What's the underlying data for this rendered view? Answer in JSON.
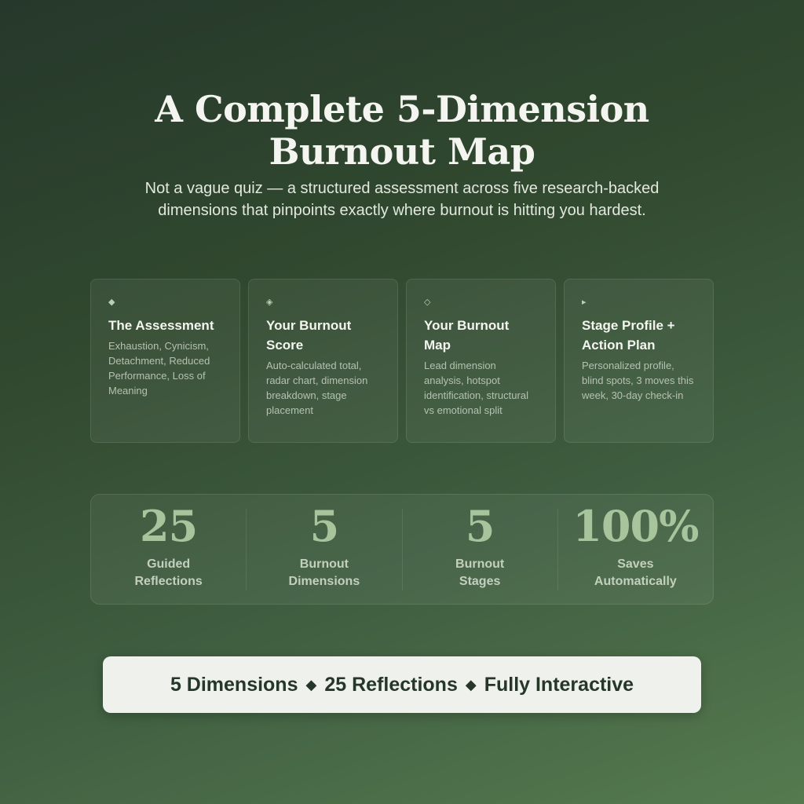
{
  "hero": {
    "title_line1": "A Complete 5-Dimension",
    "title_line2": "Burnout Map",
    "subtitle": "Not a vague quiz — a structured assessment across five research-backed dimensions that pinpoints exactly where burnout is hitting you hardest."
  },
  "features": [
    {
      "icon": "◆",
      "icon_name": "small-diamond-icon",
      "title": "The Assessment",
      "description": "Exhaustion, Cynicism, Detachment, Reduced Performance, Loss of Meaning"
    },
    {
      "icon": "◈",
      "icon_name": "diamond-in-diamond-icon",
      "title": "Your Burnout Score",
      "description": "Auto-calculated total, radar chart, dimension breakdown, stage placement"
    },
    {
      "icon": "◇",
      "icon_name": "outline-diamond-icon",
      "title": "Your Burnout Map",
      "description": "Lead dimension analysis, hotspot identification, structural vs emotional split"
    },
    {
      "icon": "▸",
      "icon_name": "triangle-right-icon",
      "title": "Stage Profile + Action Plan",
      "description": "Personalized profile, blind spots, 3 moves this week, 30-day check-in"
    }
  ],
  "stats": [
    {
      "value": "25",
      "label_line1": "Guided",
      "label_line2": "Reflections"
    },
    {
      "value": "5",
      "label_line1": "Burnout",
      "label_line2": "Dimensions"
    },
    {
      "value": "5",
      "label_line1": "Burnout",
      "label_line2": "Stages"
    },
    {
      "value": "100%",
      "label_line1": "Saves",
      "label_line2": "Automatically"
    }
  ],
  "cta": {
    "part1": "5 Dimensions",
    "separator": "◆",
    "part2": "25 Reflections",
    "part3": "Fully Interactive"
  },
  "colors": {
    "background_top": "#26382b",
    "background_bottom": "#557a4f",
    "accent_green": "#a7c49c",
    "banner_bg": "#eef1ec",
    "banner_text": "#263629"
  }
}
